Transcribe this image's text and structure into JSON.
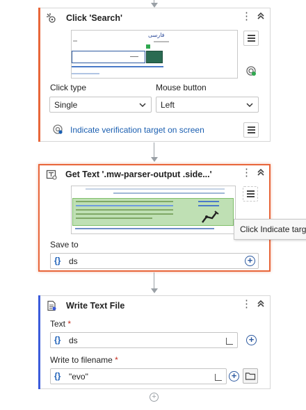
{
  "activities": {
    "click": {
      "title": "Click 'Search'",
      "icon": "click-icon",
      "thumbnail_text": "فارسی",
      "click_type_label": "Click type",
      "click_type_value": "Single",
      "mouse_button_label": "Mouse button",
      "mouse_button_value": "Left",
      "verification_link": "Indicate verification target on screen"
    },
    "get_text": {
      "title": "Get Text '.mw-parser-output .side...'",
      "icon": "get-text-icon",
      "save_to_label": "Save to",
      "save_to_value": "ds",
      "tooltip": "Click Indicate targ"
    },
    "write_file": {
      "title": "Write Text File",
      "icon": "document-icon",
      "text_label": "Text",
      "text_value": "ds",
      "filename_label": "Write to filename",
      "filename_value": "\"evo\"",
      "required_mark": "*"
    }
  },
  "icons": {
    "more": "⋮",
    "collapse": "⌃",
    "variable": "{}",
    "plus": "+",
    "chevron": "⌄"
  },
  "colors": {
    "selected_border": "#e8663a",
    "accent_click": "#e8663a",
    "accent_write": "#3b5bdb",
    "link": "#1a5eb0"
  }
}
